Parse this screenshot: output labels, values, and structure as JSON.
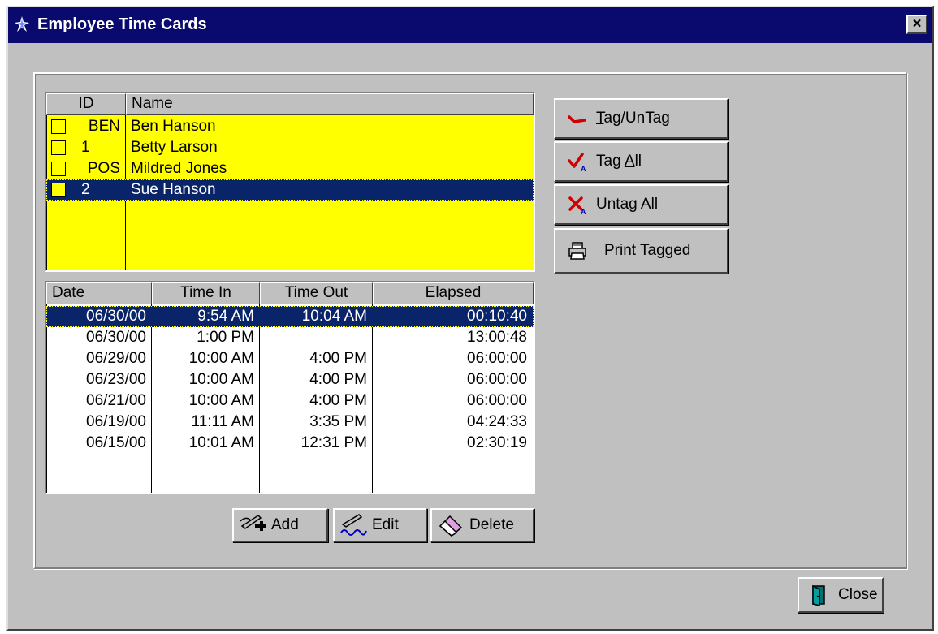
{
  "window": {
    "title": "Employee Time Cards",
    "close_glyph": "×"
  },
  "employees": {
    "columns": [
      "ID",
      "Name"
    ],
    "rows": [
      {
        "id": "BEN",
        "name": "Ben Hanson",
        "tagged": false,
        "selected": false
      },
      {
        "id": "1",
        "name": "Betty Larson",
        "tagged": false,
        "selected": false
      },
      {
        "id": "POS",
        "name": "Mildred Jones",
        "tagged": false,
        "selected": false
      },
      {
        "id": "2",
        "name": "Sue Hanson",
        "tagged": false,
        "selected": true
      }
    ]
  },
  "timecards": {
    "columns": [
      "Date",
      "Time In",
      "Time Out",
      "Elapsed"
    ],
    "rows": [
      {
        "date": "06/30/00",
        "time_in": "9:54 AM",
        "time_out": "10:04 AM",
        "elapsed": "00:10:40",
        "selected": true
      },
      {
        "date": "06/30/00",
        "time_in": "1:00 PM",
        "time_out": "",
        "elapsed": "13:00:48",
        "selected": false
      },
      {
        "date": "06/29/00",
        "time_in": "10:00 AM",
        "time_out": "4:00 PM",
        "elapsed": "06:00:00",
        "selected": false
      },
      {
        "date": "06/23/00",
        "time_in": "10:00 AM",
        "time_out": "4:00 PM",
        "elapsed": "06:00:00",
        "selected": false
      },
      {
        "date": "06/21/00",
        "time_in": "10:00 AM",
        "time_out": "4:00 PM",
        "elapsed": "06:00:00",
        "selected": false
      },
      {
        "date": "06/19/00",
        "time_in": "11:11 AM",
        "time_out": "3:35 PM",
        "elapsed": "04:24:33",
        "selected": false
      },
      {
        "date": "06/15/00",
        "time_in": "10:01 AM",
        "time_out": "12:31 PM",
        "elapsed": "02:30:19",
        "selected": false
      }
    ]
  },
  "tag_buttons": {
    "tag_untag": {
      "mnemonic": "T",
      "rest": "ag/UnTag",
      "icon": "red-check-icon"
    },
    "tag_all": {
      "before": "Tag ",
      "mnemonic": "A",
      "rest": "ll",
      "icon": "check-all-icon"
    },
    "untag_all": {
      "label": "Untag All",
      "icon": "x-all-icon"
    },
    "print_tagged": {
      "label": "Print Tagged",
      "icon": "printer-icon"
    }
  },
  "record_buttons": {
    "add": {
      "label": "Add",
      "icon": "pen-plus-icon"
    },
    "edit": {
      "label": "Edit",
      "icon": "pen-edit-icon"
    },
    "delete": {
      "label": "Delete",
      "icon": "eraser-icon"
    }
  },
  "close_button": {
    "label": "Close",
    "icon": "door-icon"
  },
  "colors": {
    "titlebar": "#0a0a6e",
    "window_face": "#c0c0c0",
    "list_background": "#ffff00",
    "selection": "#0a246a"
  }
}
